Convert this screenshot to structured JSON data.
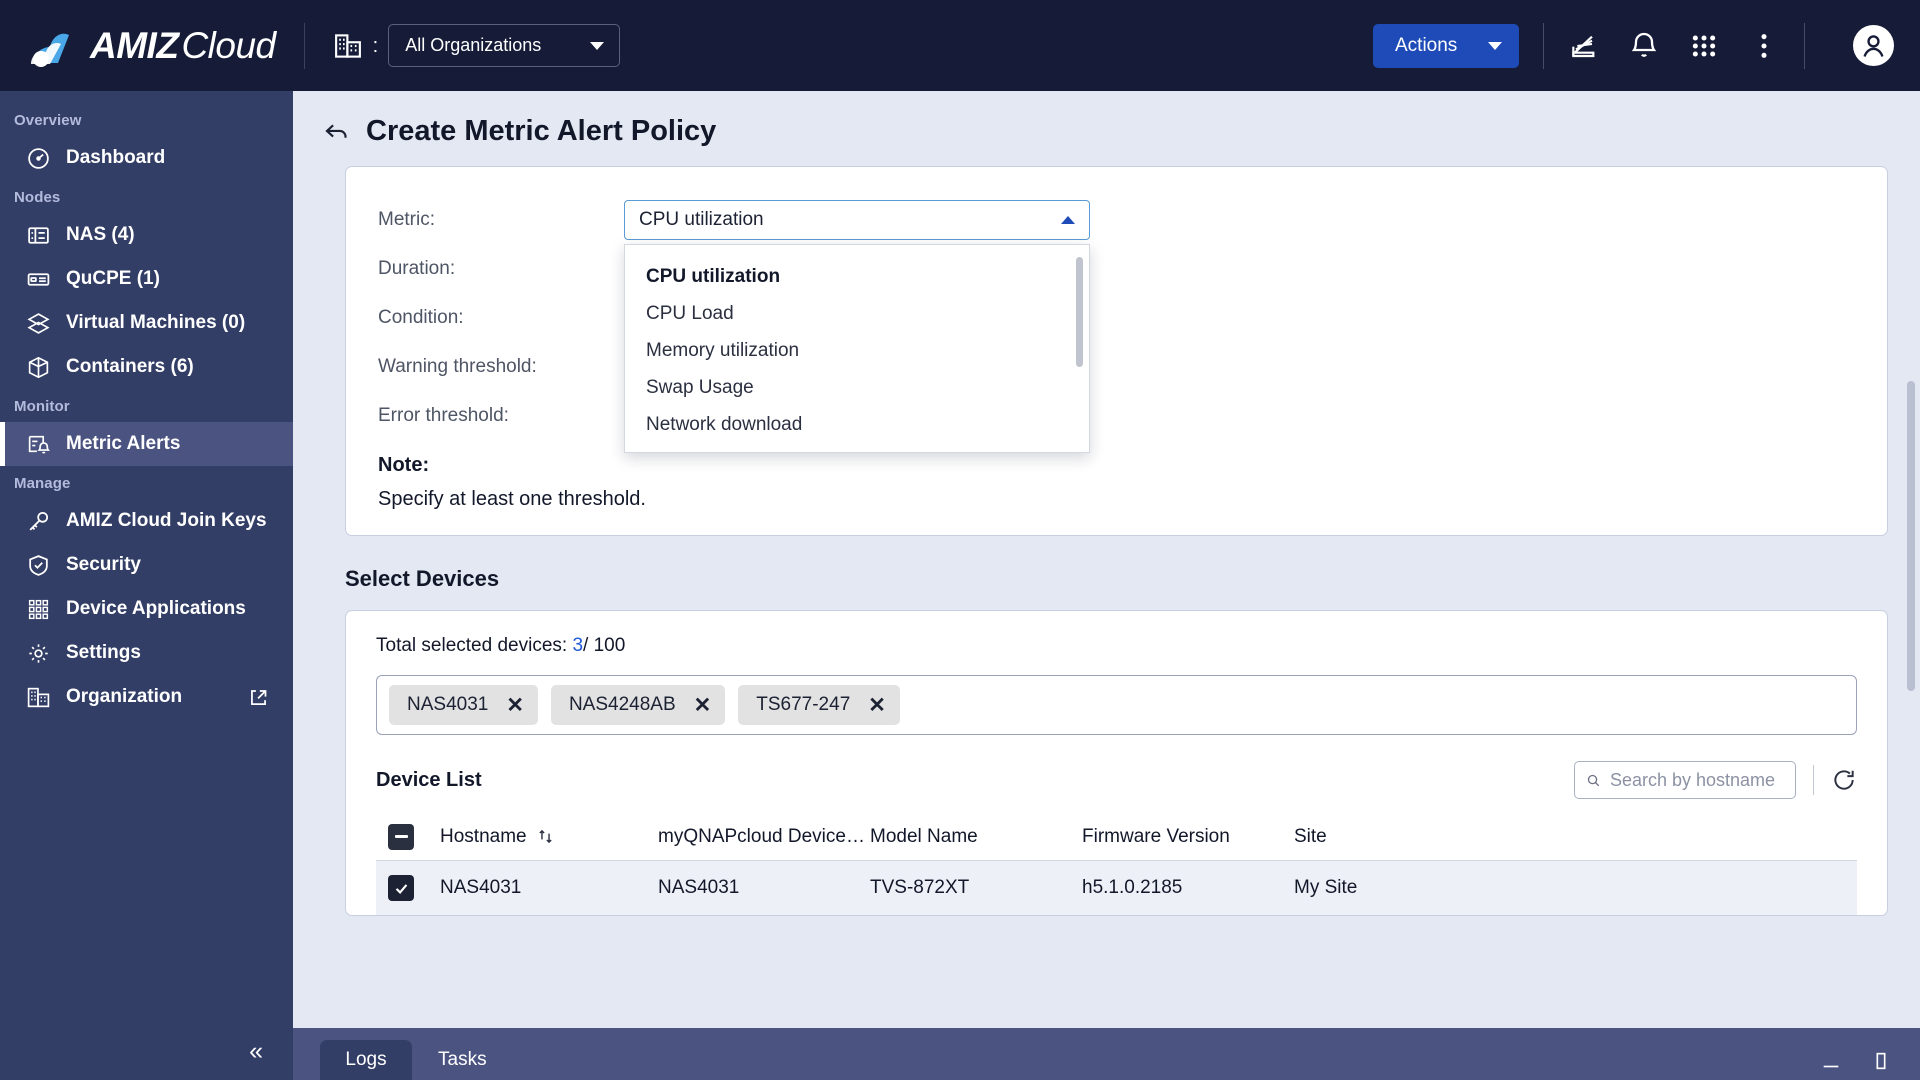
{
  "header": {
    "brand_amiz": "AMIZ",
    "brand_cloud": "Cloud",
    "org_colon": ":",
    "org_selected": "All Organizations",
    "actions_label": "Actions"
  },
  "sidebar": {
    "groups": [
      {
        "label": "Overview",
        "items": [
          {
            "label": "Dashboard",
            "icon": "dashboard-icon",
            "active": false
          }
        ]
      },
      {
        "label": "Nodes",
        "items": [
          {
            "label": "NAS (4)",
            "icon": "nas-icon",
            "active": false
          },
          {
            "label": "QuCPE (1)",
            "icon": "qucpe-icon",
            "active": false
          },
          {
            "label": "Virtual Machines (0)",
            "icon": "vm-icon",
            "active": false
          },
          {
            "label": "Containers (6)",
            "icon": "container-icon",
            "active": false
          }
        ]
      },
      {
        "label": "Monitor",
        "items": [
          {
            "label": "Metric Alerts",
            "icon": "metric-alerts-icon",
            "active": true
          }
        ]
      },
      {
        "label": "Manage",
        "items": [
          {
            "label": "AMIZ Cloud Join Keys",
            "icon": "key-icon",
            "active": false
          },
          {
            "label": "Security",
            "icon": "shield-icon",
            "active": false
          },
          {
            "label": "Device Applications",
            "icon": "apps-grid-icon",
            "active": false
          },
          {
            "label": "Settings",
            "icon": "gear-icon",
            "active": false
          },
          {
            "label": "Organization",
            "icon": "building-icon",
            "active": false,
            "external": true
          }
        ]
      }
    ],
    "collapse_glyph": "«"
  },
  "page": {
    "title": "Create Metric Alert Policy"
  },
  "form": {
    "labels": {
      "metric": "Metric:",
      "duration": "Duration:",
      "condition": "Condition:",
      "warning_threshold": "Warning threshold:",
      "error_threshold": "Error threshold:"
    },
    "metric_value": "CPU utilization",
    "metric_options": [
      "CPU utilization",
      "CPU Load",
      "Memory utilization",
      "Swap Usage",
      "Network download"
    ],
    "metric_selected_index": 0,
    "note_title": "Note:",
    "note_text": "Specify at least one threshold."
  },
  "devices": {
    "section_title": "Select Devices",
    "total_prefix": "Total selected devices: ",
    "total_count": "3",
    "total_suffix": "/ 100",
    "chips": [
      {
        "label": "NAS4031",
        "close": "✕"
      },
      {
        "label": "NAS4248AB",
        "close": "✕"
      },
      {
        "label": "TS677-247",
        "close": "✕"
      }
    ],
    "device_list_title": "Device List",
    "search_placeholder": "Search by hostname",
    "search_value": "",
    "columns": [
      "Hostname",
      "myQNAPcloud Device N...",
      "Model Name",
      "Firmware Version",
      "Site"
    ],
    "rows": [
      {
        "checked": true,
        "hostname": "NAS4031",
        "myqnapcloud": "NAS4031",
        "model": "TVS-872XT",
        "firmware": "h5.1.0.2185",
        "site": "My Site"
      }
    ]
  },
  "bottombar": {
    "tabs": [
      {
        "label": "Logs",
        "active": true
      },
      {
        "label": "Tasks",
        "active": false
      }
    ],
    "minimize_glyph": "—",
    "maximize_glyph": "▯"
  }
}
